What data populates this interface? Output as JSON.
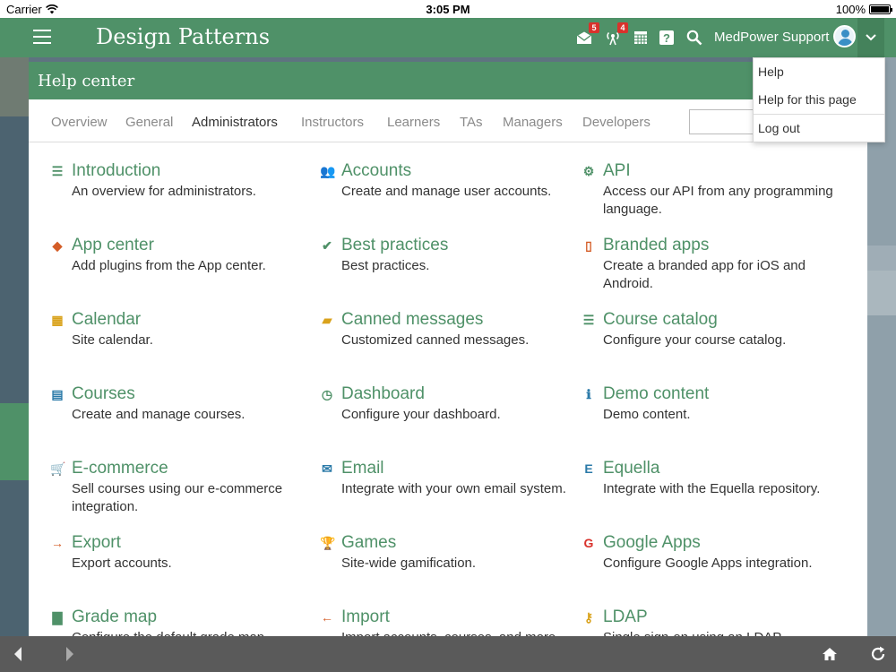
{
  "status_bar": {
    "carrier": "Carrier",
    "time": "3:05 PM",
    "battery": "100%",
    "battery_level": 1.0
  },
  "app": {
    "title": "Design Patterns",
    "notifications": [
      {
        "icon": "mail-icon",
        "count": "5"
      },
      {
        "icon": "broadcast-icon",
        "count": "4"
      }
    ],
    "user_name": "MedPower Support"
  },
  "help_center": {
    "title": "Help center",
    "tabs": [
      "Overview",
      "General",
      "Administrators",
      "Instructors",
      "Learners",
      "TAs",
      "Managers",
      "Developers"
    ],
    "active_tab": "Administrators",
    "search_value": "",
    "entries": [
      {
        "icon": "list-icon",
        "color": "#4f9168",
        "glyph": "☰",
        "title": "Introduction",
        "desc": "An overview for administrators."
      },
      {
        "icon": "users-icon",
        "color": "#2b7aa8",
        "glyph": "👥",
        "title": "Accounts",
        "desc": "Create and manage user accounts."
      },
      {
        "icon": "gear-icon",
        "color": "#4f9168",
        "glyph": "⚙",
        "title": "API",
        "desc": "Access our API from any programming language."
      },
      {
        "icon": "app-center-icon",
        "color": "#d45d27",
        "glyph": "◆",
        "title": "App center",
        "desc": "Add plugins from the App center."
      },
      {
        "icon": "checkmark-icon",
        "color": "#4f9168",
        "glyph": "✔",
        "title": "Best practices",
        "desc": "Best practices."
      },
      {
        "icon": "mobile-phone-icon",
        "color": "#d45d27",
        "glyph": "▯",
        "title": "Branded apps",
        "desc": "Create a branded app for iOS and Android."
      },
      {
        "icon": "calendar-icon",
        "color": "#d9a21b",
        "glyph": "▦",
        "title": "Calendar",
        "desc": "Site calendar."
      },
      {
        "icon": "chat-bubbles-icon",
        "color": "#d9a21b",
        "glyph": "▰",
        "title": "Canned messages",
        "desc": "Customized canned messages."
      },
      {
        "icon": "list-icon",
        "color": "#4f9168",
        "glyph": "☰",
        "title": "Course catalog",
        "desc": "Configure your course catalog."
      },
      {
        "icon": "course-calendar-icon",
        "color": "#2b7aa8",
        "glyph": "▤",
        "title": "Courses",
        "desc": "Create and manage courses."
      },
      {
        "icon": "dashboard-clock-icon",
        "color": "#4f9168",
        "glyph": "◷",
        "title": "Dashboard",
        "desc": "Configure your dashboard."
      },
      {
        "icon": "info-icon",
        "color": "#2b7aa8",
        "glyph": "ℹ",
        "title": "Demo content",
        "desc": "Demo content."
      },
      {
        "icon": "shopping-cart-icon",
        "color": "#d9a21b",
        "glyph": "🛒",
        "title": "E-commerce",
        "desc": "Sell courses using our e-commerce integration."
      },
      {
        "icon": "envelope-icon",
        "color": "#2b7aa8",
        "glyph": "✉",
        "title": "Email",
        "desc": "Integrate with your own email system."
      },
      {
        "icon": "equella-icon",
        "color": "#2b7aa8",
        "glyph": "E",
        "title": "Equella",
        "desc": "Integrate with the Equella repository."
      },
      {
        "icon": "arrow-right-icon",
        "color": "#d45d27",
        "glyph": "→",
        "title": "Export",
        "desc": "Export accounts."
      },
      {
        "icon": "trophy-icon",
        "color": "#d9a21b",
        "glyph": "🏆",
        "title": "Games",
        "desc": "Site-wide gamification."
      },
      {
        "icon": "google-icon",
        "color": "#d9322c",
        "glyph": "G",
        "title": "Google Apps",
        "desc": "Configure Google Apps integration."
      },
      {
        "icon": "bar-chart-icon",
        "color": "#4f9168",
        "glyph": "▇",
        "title": "Grade map",
        "desc": "Configure the default grade map."
      },
      {
        "icon": "arrow-left-icon",
        "color": "#d45d27",
        "glyph": "←",
        "title": "Import",
        "desc": "Import accounts, courses, and more."
      },
      {
        "icon": "key-icon",
        "color": "#d9a21b",
        "glyph": "⚷",
        "title": "LDAP",
        "desc": "Single sign-on using an LDAP."
      }
    ]
  },
  "dropdown": {
    "items": [
      "Help",
      "Help for this page",
      "Log out"
    ]
  }
}
